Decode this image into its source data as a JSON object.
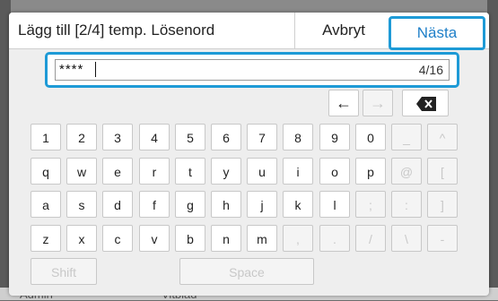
{
  "background": {
    "left_text": "Admin",
    "center_text": "Vitblad"
  },
  "dialog": {
    "title": "Lägg till [2/4] temp. Lösenord",
    "cancel_label": "Avbryt",
    "next_label": "Nästa",
    "input": {
      "value": "****",
      "counter": "4/16"
    },
    "nav": {
      "left_icon": "arrow-left-icon",
      "right_icon": "arrow-right-icon",
      "backspace_icon": "backspace-icon"
    },
    "rows": [
      [
        "1",
        "2",
        "3",
        "4",
        "5",
        "6",
        "7",
        "8",
        "9",
        "0",
        "_",
        "^"
      ],
      [
        "q",
        "w",
        "e",
        "r",
        "t",
        "y",
        "u",
        "i",
        "o",
        "p",
        "@",
        "["
      ],
      [
        "a",
        "s",
        "d",
        "f",
        "g",
        "h",
        "j",
        "k",
        "l",
        ";",
        ":",
        "]"
      ],
      [
        "z",
        "x",
        "c",
        "v",
        "b",
        "n",
        "m",
        ",",
        ".",
        "/",
        "\\",
        "-"
      ]
    ],
    "disabled_keys": [
      "_",
      "^",
      "@",
      "[",
      ";",
      ":",
      "]",
      ",",
      ".",
      "/",
      "\\",
      "-"
    ],
    "shift_label": "Shift",
    "space_label": "Space"
  },
  "colors": {
    "accent": "#1e9ad6",
    "accent_text": "#1e7fc8"
  }
}
